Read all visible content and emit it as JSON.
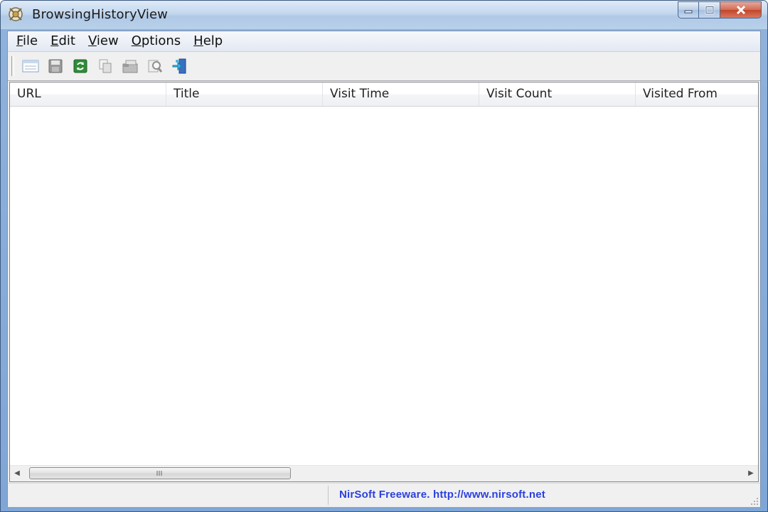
{
  "window": {
    "title": "BrowsingHistoryView"
  },
  "menu": {
    "items": [
      {
        "key": "F",
        "rest": "ile"
      },
      {
        "key": "E",
        "rest": "dit"
      },
      {
        "key": "V",
        "rest": "iew"
      },
      {
        "key": "O",
        "rest": "ptions"
      },
      {
        "key": "H",
        "rest": "elp"
      }
    ]
  },
  "toolbar": {
    "icons": [
      "properties-icon",
      "save-icon",
      "refresh-icon",
      "copy-icon",
      "html-report-icon",
      "find-icon",
      "exit-icon"
    ]
  },
  "table": {
    "columns": [
      "URL",
      "Title",
      "Visit Time",
      "Visit Count",
      "Visited From"
    ],
    "rows": []
  },
  "scrollbar": {
    "grip": "III"
  },
  "status": {
    "text": "NirSoft Freeware.  http://www.nirsoft.net"
  },
  "colors": {
    "status_link": "#2b3fe0",
    "close_button": "#c2452b"
  }
}
